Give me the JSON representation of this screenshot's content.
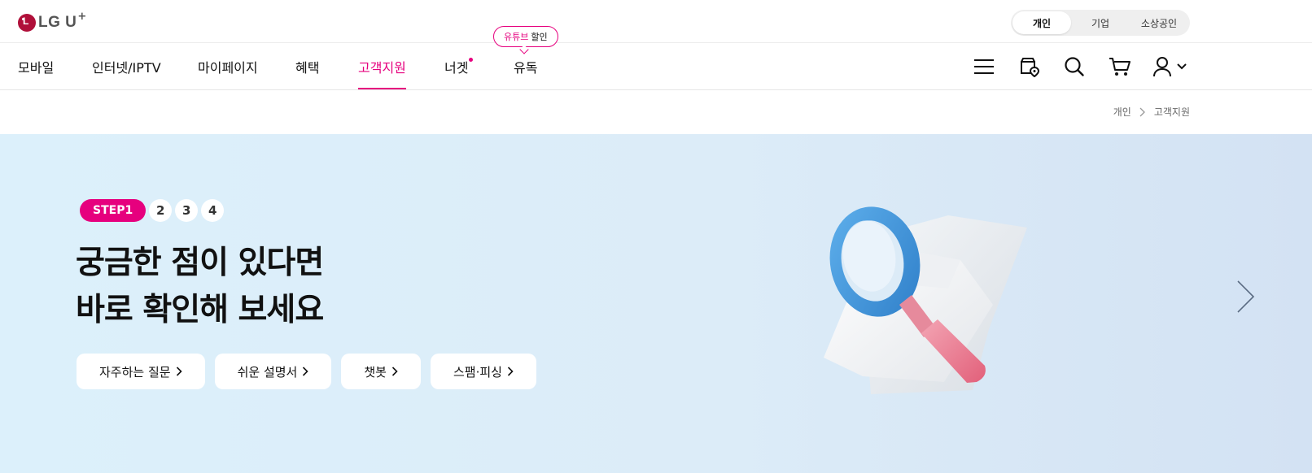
{
  "brand": {
    "logo_text": "LG U",
    "logo_plus": "+"
  },
  "segments": [
    {
      "label": "개인",
      "active": true
    },
    {
      "label": "기업",
      "active": false
    },
    {
      "label": "소상공인",
      "active": false
    }
  ],
  "nav": {
    "items": [
      {
        "label": "모바일",
        "active": false
      },
      {
        "label": "인터넷/IPTV",
        "active": false
      },
      {
        "label": "마이페이지",
        "active": false
      },
      {
        "label": "혜택",
        "active": false
      },
      {
        "label": "고객지원",
        "active": true
      },
      {
        "label": "너겟",
        "active": false,
        "new_dot": true
      },
      {
        "label": "유독",
        "active": false
      }
    ],
    "promo_bubble": {
      "highlight": "유튜브",
      "text": "할인"
    },
    "icons": [
      "menu-icon",
      "store-location-icon",
      "search-icon",
      "cart-icon",
      "user-icon"
    ],
    "accent_color": "#e6007e"
  },
  "breadcrumb": {
    "items": [
      "개인",
      "고객지원"
    ]
  },
  "hero": {
    "steps": {
      "active_label": "STEP1",
      "others": [
        "2",
        "3",
        "4"
      ]
    },
    "title_lines": [
      "궁금한 점이 있다면",
      "바로 확인해 보세요"
    ],
    "quick_links": [
      "자주하는 질문",
      "쉬운 설명서",
      "챗봇",
      "스팸·피싱"
    ],
    "illustration": "magnifying-glass-over-documents",
    "background_colors": [
      "#dcf0fb",
      "#d3e2f3"
    ]
  }
}
